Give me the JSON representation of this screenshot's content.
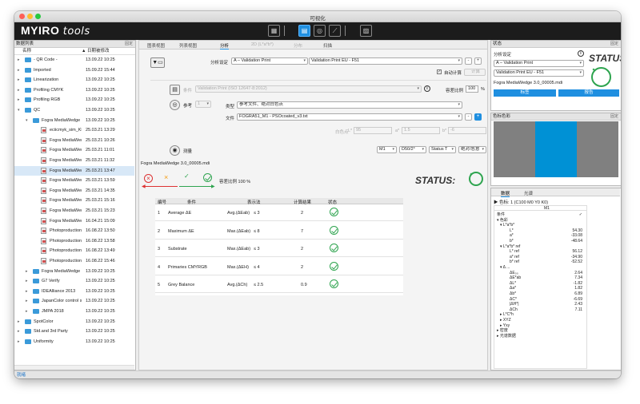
{
  "window": {
    "title": "可视化"
  },
  "app": {
    "logo_main": "MYIRO",
    "logo_sub": "tools"
  },
  "toolbar": {
    "icons": [
      "grid-icon",
      "screen-icon",
      "target-icon",
      "curve-icon",
      "document-icon"
    ]
  },
  "left_panel": {
    "title": "数据列表",
    "pin": "固定",
    "col_name": "名称",
    "col_date": "▲ 日期被修改",
    "rows": [
      {
        "name": "- QR Code -",
        "date": "13.09.22 10:25",
        "indent": 0,
        "type": "folder",
        "expand": "▸"
      },
      {
        "name": "Imported",
        "date": "15.09.22 15:44",
        "indent": 0,
        "type": "folder",
        "expand": "▸"
      },
      {
        "name": "Linearization",
        "date": "13.09.22 10:25",
        "indent": 0,
        "type": "folder",
        "expand": "▸"
      },
      {
        "name": "Profiling CMYK",
        "date": "13.09.22 10:25",
        "indent": 0,
        "type": "folder",
        "expand": "▸"
      },
      {
        "name": "Profiling RGB",
        "date": "13.09.22 10:25",
        "indent": 0,
        "type": "folder",
        "expand": "▸"
      },
      {
        "name": "QC",
        "date": "13.09.22 10:25",
        "indent": 0,
        "type": "folder",
        "expand": "▾"
      },
      {
        "name": "Fogra MediaWedge 3...",
        "date": "13.09.22 10:25",
        "indent": 1,
        "type": "folder",
        "expand": "▾"
      },
      {
        "name": "eciicmyk_sim_KM...",
        "date": "25.03.21 13:29",
        "indent": 2,
        "type": "doc",
        "expand": ""
      },
      {
        "name": "Fogra MediaWed...",
        "date": "25.03.21 10:26",
        "indent": 2,
        "type": "doc",
        "expand": ""
      },
      {
        "name": "Fogra MediaWed...",
        "date": "25.03.21 11:01",
        "indent": 2,
        "type": "doc",
        "expand": ""
      },
      {
        "name": "Fogra MediaWed...",
        "date": "25.03.21 11:32",
        "indent": 2,
        "type": "doc",
        "expand": ""
      },
      {
        "name": "Fogra MediaWed...",
        "date": "25.03.21 13:47",
        "indent": 2,
        "type": "doc",
        "expand": "",
        "selected": true
      },
      {
        "name": "Fogra MediaWed...",
        "date": "25.03.21 13:59",
        "indent": 2,
        "type": "doc",
        "expand": ""
      },
      {
        "name": "Fogra MediaWed...",
        "date": "25.03.21 14:35",
        "indent": 2,
        "type": "doc",
        "expand": ""
      },
      {
        "name": "Fogra MediaWed...",
        "date": "25.03.21 15:16",
        "indent": 2,
        "type": "doc",
        "expand": ""
      },
      {
        "name": "Fogra MediaWed...",
        "date": "25.03.21 15:23",
        "indent": 2,
        "type": "doc",
        "expand": ""
      },
      {
        "name": "Fogra MediaWed...",
        "date": "16.04.21 15:09",
        "indent": 2,
        "type": "doc",
        "expand": ""
      },
      {
        "name": "Photoproduction_...",
        "date": "16.08.22 13:50",
        "indent": 2,
        "type": "doc",
        "expand": ""
      },
      {
        "name": "Photoproduction_...",
        "date": "16.08.22 13:58",
        "indent": 2,
        "type": "doc",
        "expand": ""
      },
      {
        "name": "Photoproduction_...",
        "date": "16.08.22 13:49",
        "indent": 2,
        "type": "doc",
        "expand": ""
      },
      {
        "name": "Photoproduction_...",
        "date": "16.08.22 15:46",
        "indent": 2,
        "type": "doc",
        "expand": ""
      },
      {
        "name": "Fogra MediaWedge R...",
        "date": "13.09.22 10:25",
        "indent": 1,
        "type": "folder",
        "expand": "▸"
      },
      {
        "name": "G7 Verify",
        "date": "13.09.22 10:25",
        "indent": 1,
        "type": "folder",
        "expand": "▸"
      },
      {
        "name": "IDEAlliance 2013",
        "date": "13.09.22 10:25",
        "indent": 1,
        "type": "folder",
        "expand": "▸"
      },
      {
        "name": "JapanColor control st...",
        "date": "13.09.22 10:25",
        "indent": 1,
        "type": "folder",
        "expand": "▸"
      },
      {
        "name": "JMPA 2018",
        "date": "13.09.22 10:25",
        "indent": 1,
        "type": "folder",
        "expand": "▸"
      },
      {
        "name": "SpotColor",
        "date": "13.09.22 10:25",
        "indent": 0,
        "type": "folder",
        "expand": "▸"
      },
      {
        "name": "Std.and 3rd Party",
        "date": "13.09.22 10:25",
        "indent": 0,
        "type": "folder",
        "expand": "▸"
      },
      {
        "name": "Uniformity",
        "date": "13.09.22 10:25",
        "indent": 0,
        "type": "folder",
        "expand": "▸"
      }
    ]
  },
  "main": {
    "tabs": [
      {
        "label": "图表视图",
        "state": "normal"
      },
      {
        "label": "列表视图",
        "state": "normal"
      },
      {
        "label": "分析",
        "state": "active"
      },
      {
        "label": "2D (L*a*b*)",
        "state": "disabled"
      },
      {
        "label": "分布",
        "state": "disabled"
      },
      {
        "label": "扫描",
        "state": "normal"
      }
    ],
    "analysis_label": "分析设定",
    "analysis_value": "A – Validation Print",
    "analysis_value2": "Validation Print EU - F51",
    "auto_calc": "自动计算",
    "calc_btn": "计算",
    "condition_label": "条件",
    "condition_value": "Validation Print (ISO 12647-8:2012)",
    "tolerance_label": "容差比例",
    "tolerance_value": "100",
    "percent": "%",
    "reference_label": "参考",
    "reference_num": "1",
    "type_label": "类型",
    "type_value": "参考文件、绝对白色点",
    "file_label": "文件",
    "file_value": "FOGRA51_M1 - PSOcoated_v3.txt",
    "whitepoint_label": "白色点",
    "wp_l_label": "L*",
    "wp_l": "95",
    "wp_a_label": "a*",
    "wp_a": "1.5",
    "wp_b_label": "b*",
    "wp_b": "-6",
    "measure_label": "测量",
    "m_mode": "M1",
    "m_illum": "D50/2°",
    "m_status": "Status T",
    "m_abs": "绝对/恶意",
    "file_name": "Fogra MediaWedge 3.0_00005.mdi",
    "tolerance_ratio": "容差比例 100 %",
    "status_label": "STATUS:",
    "table": {
      "headers": [
        "编号",
        "条件",
        "表示法",
        "计算结果",
        "状态"
      ],
      "rows": [
        {
          "no": "1",
          "cond": "Average ΔE",
          "notation": "Avg.(ΔEab)",
          "op": "≤ 3",
          "result": "2"
        },
        {
          "no": "2",
          "cond": "Maximum ΔE",
          "notation": "Max.(ΔEab)",
          "op": "≤ 8",
          "result": "7"
        },
        {
          "no": "3",
          "cond": "Substrate",
          "notation": "Max.(ΔEab)",
          "op": "≤ 3",
          "result": "2"
        },
        {
          "no": "4",
          "cond": "Primaries CMYRGB",
          "notation": "Max.(ΔEH)",
          "op": "≤ 4",
          "result": "2"
        },
        {
          "no": "5",
          "cond": "Grey Balance",
          "notation": "Avg.(ΔCh)",
          "op": "≤ 2.5",
          "result": "0.9"
        }
      ]
    }
  },
  "right": {
    "status_title": "状态",
    "pin": "固定",
    "analysis_label": "分析设定",
    "sel1": "A – Validation Print",
    "sel2": "Validation Print EU - F51",
    "file": "Fogra MediaWedge 3.0_00005.mdi",
    "btn_label": "标签",
    "btn_report": "报告",
    "status_word": "STATUS:",
    "colors_title": "色标色彩",
    "colors_pin": "固定",
    "swatch_colors": [
      "#808080",
      "#0091d5",
      "#808080"
    ],
    "data_tab": "数据",
    "spectrum_tab": "光谱",
    "patch_line": "色标:  1 (C100 M0 Y0 K0)",
    "col_m1": "M1",
    "data_rows": [
      {
        "k": "条件",
        "v": "✓",
        "ind": 0
      },
      {
        "k": "▾ 色彩",
        "v": "",
        "ind": 0
      },
      {
        "k": "▾ L*a*b*",
        "v": "",
        "ind": 1
      },
      {
        "k": "L*",
        "v": "54.30",
        "ind": 4
      },
      {
        "k": "a*",
        "v": "-33.08",
        "ind": 4
      },
      {
        "k": "b*",
        "v": "-48.64",
        "ind": 4
      },
      {
        "k": "▾ L*a*b* ref",
        "v": "",
        "ind": 1
      },
      {
        "k": "L* ref",
        "v": "56.12",
        "ind": 4
      },
      {
        "k": "a* ref",
        "v": "-34.90",
        "ind": 4
      },
      {
        "k": "b* ref",
        "v": "-52.52",
        "ind": 4
      },
      {
        "k": "▾ Δ ...",
        "v": "",
        "ind": 1
      },
      {
        "k": "ΔE₀₀",
        "v": "2.64",
        "ind": 4
      },
      {
        "k": "ΔE*ab",
        "v": "7.34",
        "ind": 4
      },
      {
        "k": "ΔL*",
        "v": "-1.82",
        "ind": 4
      },
      {
        "k": "Δa*",
        "v": "1.82",
        "ind": 4
      },
      {
        "k": "Δb*",
        "v": "6.89",
        "ind": 4
      },
      {
        "k": "ΔC*",
        "v": "-6.69",
        "ind": 4
      },
      {
        "k": "|ΔH*|",
        "v": "2.43",
        "ind": 4
      },
      {
        "k": "ΔCh",
        "v": "7.11",
        "ind": 4
      },
      {
        "k": "▸ L*C*h",
        "v": "",
        "ind": 1
      },
      {
        "k": "▸ XYZ",
        "v": "",
        "ind": 1
      },
      {
        "k": "▸ Yxy",
        "v": "",
        "ind": 1
      },
      {
        "k": "▸ 密度",
        "v": "",
        "ind": 0
      },
      {
        "k": "▸ 光谱数据",
        "v": "",
        "ind": 0
      }
    ]
  },
  "statusbar": {
    "text": "就绪"
  },
  "colors": {
    "accent": "#1f8fe0",
    "ok": "#2ea44f",
    "selected_row": "#d8e8f7"
  }
}
